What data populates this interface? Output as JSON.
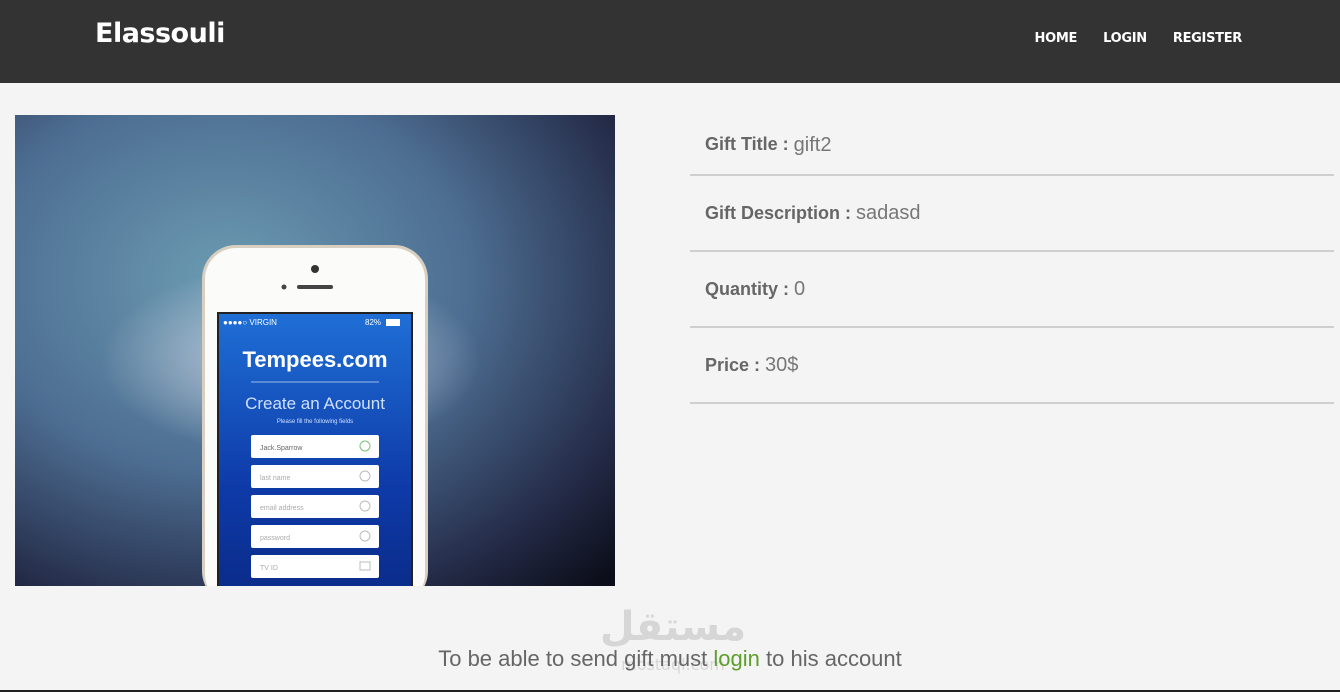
{
  "navbar": {
    "brand": "Elassouli",
    "links": [
      "HOME",
      "LOGIN",
      "REGISTER"
    ]
  },
  "image": {
    "screen_status": "●●●●○ VIRGIN",
    "screen_battery": "82%",
    "screen_title": "Tempees.com",
    "screen_subtitle": "Create an Account",
    "screen_hint": "Please fill the following fields",
    "fields": [
      "Jack.Sparrow",
      "last name",
      "email address",
      "password",
      "TV ID"
    ]
  },
  "details": {
    "title_label": "Gift Title :",
    "title_value": "gift2",
    "description_label": "Gift Description :",
    "description_value": "sadasd",
    "quantity_label": "Quantity :",
    "quantity_value": "0",
    "price_label": "Price :",
    "price_value": "30$"
  },
  "notice": {
    "before": "To be able to send gift must",
    "link": "login",
    "after": "to his account"
  },
  "watermark": {
    "arabic": "مستقل",
    "latin": "mostaql.com"
  },
  "colors": {
    "navbar": "#333333",
    "background": "#f4f4f4",
    "link_green": "#5e9e2b"
  }
}
